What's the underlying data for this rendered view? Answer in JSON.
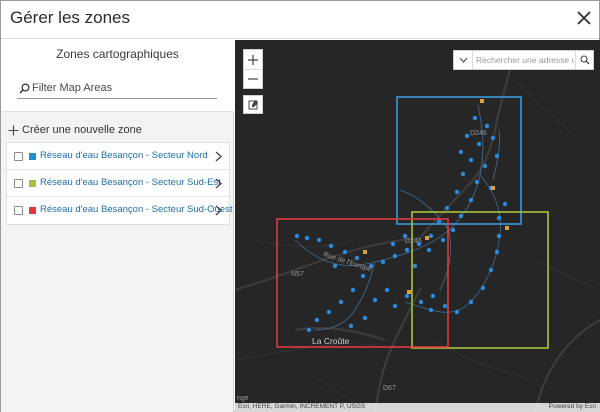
{
  "window": {
    "title": "Gérer les zones"
  },
  "sidebar": {
    "heading": "Zones cartographiques",
    "filter_placeholder": "Filter Map Areas",
    "create_label": "Créer une nouvelle zone",
    "zones": [
      {
        "name": "Réseau d'eau Besançon - Secteur Nord",
        "color": "#1f8fd2"
      },
      {
        "name": "Réseau d'eau Besançon - Secteur Sud-Est",
        "color": "#a3c23a"
      },
      {
        "name": "Réseau d'eau Besançon - Secteur Sud-Ouest",
        "color": "#e0363c"
      }
    ]
  },
  "map": {
    "search_placeholder": "Rechercher une adresse o",
    "labels": {
      "d246_top": "D246",
      "d246_mid": "D246",
      "n57": "N57",
      "d67": "D67",
      "la_croute": "La Croûte",
      "street": "Rue de l'Europe",
      "edge": "nge"
    },
    "attribution_left": "Esri, HERE, Garmin, INCREMENT P, USGS",
    "attribution_right": "Powered by Esri",
    "zone_colors": {
      "nord": "#3a9ad9",
      "sud_est": "#a7c43c",
      "sud_ouest": "#df3b3f"
    },
    "background": "#262626",
    "point_color": "#2a8be0",
    "valve_color": "#e0a040"
  }
}
